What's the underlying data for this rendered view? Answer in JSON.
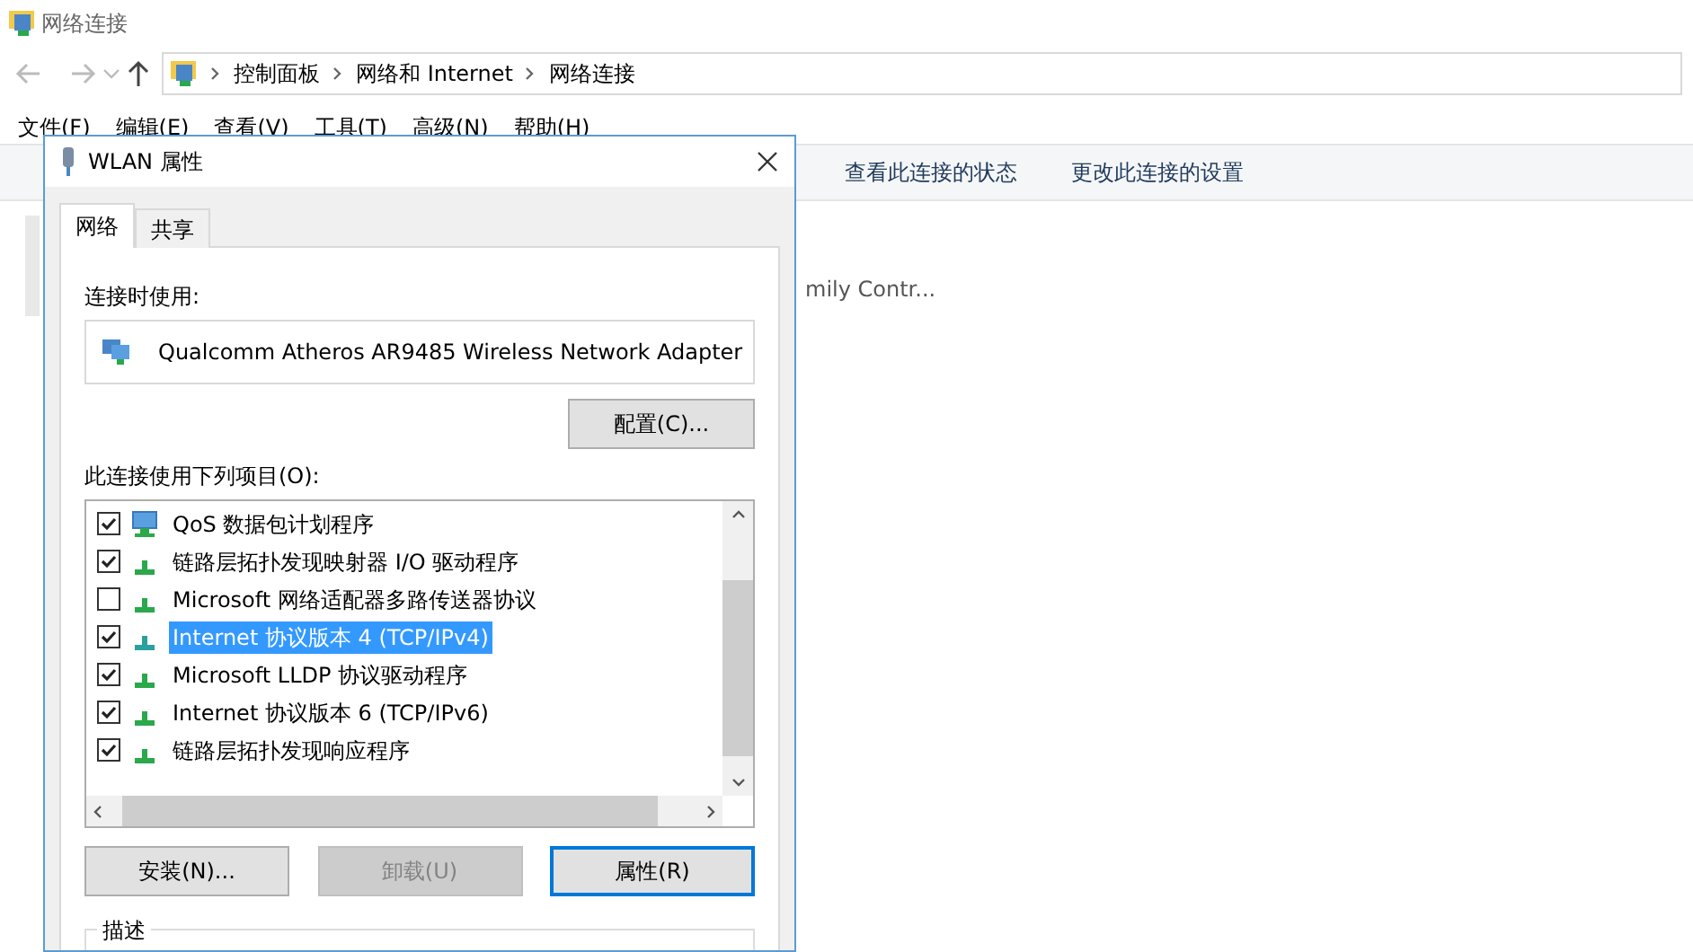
{
  "window": {
    "title": "网络连接"
  },
  "address_bar": {
    "crumbs": [
      "控制面板",
      "网络和 Internet",
      "网络连接"
    ]
  },
  "menu": [
    "文件(F)",
    "编辑(E)",
    "查看(V)",
    "工具(T)",
    "高级(N)",
    "帮助(H)"
  ],
  "command_bar": [
    "查看此连接的状态",
    "更改此连接的设置"
  ],
  "content": {
    "item_text": "mily Contr..."
  },
  "dialog": {
    "title": "WLAN 属性",
    "tabs": [
      {
        "label": "网络",
        "selected": true
      },
      {
        "label": "共享",
        "selected": false
      }
    ],
    "connect_using_label": "连接时使用:",
    "adapter": "Qualcomm Atheros AR9485 Wireless Network Adapter",
    "configure_button": "配置(C)...",
    "items_label": "此连接使用下列项目(O):",
    "items": [
      {
        "label": "QoS 数据包计划程序",
        "checked": true,
        "selected": false,
        "kind": "service"
      },
      {
        "label": "链路层拓扑发现映射器 I/O 驱动程序",
        "checked": true,
        "selected": false,
        "kind": "protocol"
      },
      {
        "label": "Microsoft 网络适配器多路传送器协议",
        "checked": false,
        "selected": false,
        "kind": "protocol"
      },
      {
        "label": "Internet 协议版本 4 (TCP/IPv4)",
        "checked": true,
        "selected": true,
        "kind": "protocol"
      },
      {
        "label": "Microsoft LLDP 协议驱动程序",
        "checked": true,
        "selected": false,
        "kind": "protocol"
      },
      {
        "label": "Internet 协议版本 6 (TCP/IPv6)",
        "checked": true,
        "selected": false,
        "kind": "protocol"
      },
      {
        "label": "链路层拓扑发现响应程序",
        "checked": true,
        "selected": false,
        "kind": "protocol"
      }
    ],
    "buttons": [
      {
        "label": "安装(N)...",
        "disabled": false,
        "focused": false
      },
      {
        "label": "卸载(U)",
        "disabled": true,
        "focused": false
      },
      {
        "label": "属性(R)",
        "disabled": false,
        "focused": true
      }
    ],
    "description_label": "描述"
  }
}
